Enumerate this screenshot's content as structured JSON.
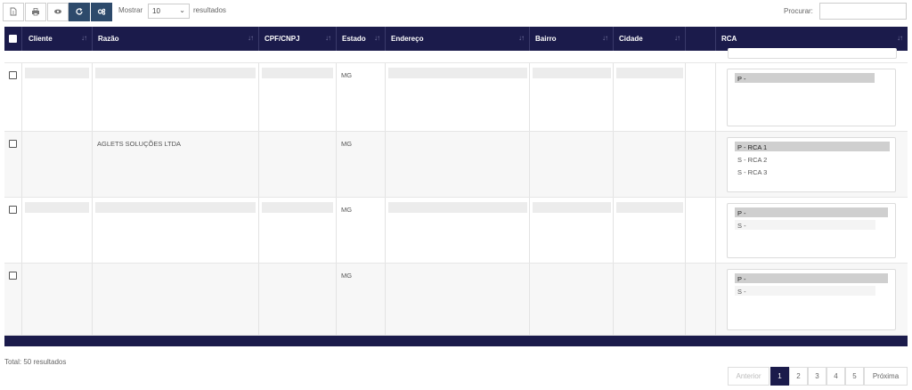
{
  "toolbar": {
    "buttons": [
      {
        "name": "file-icon"
      },
      {
        "name": "print-icon"
      },
      {
        "name": "eye-icon"
      },
      {
        "name": "refresh-icon"
      },
      {
        "name": "settings-icon"
      }
    ],
    "show_label": "Mostrar",
    "page_size": "10",
    "results_label": "resultados",
    "search_label": "Procurar:",
    "search_value": ""
  },
  "columns": [
    {
      "label": ""
    },
    {
      "label": "Cliente"
    },
    {
      "label": "Razão"
    },
    {
      "label": "CPF/CNPJ"
    },
    {
      "label": "Estado"
    },
    {
      "label": "Endereço"
    },
    {
      "label": "Bairro"
    },
    {
      "label": "Cidade"
    },
    {
      "label": ""
    },
    {
      "label": "RCA"
    }
  ],
  "rows": [
    {
      "cliente": "",
      "razao": "",
      "cpf": "",
      "estado": "MG",
      "endereco": "",
      "bairro": "",
      "cidade": "",
      "rca": [
        {
          "text": "P -",
          "kind": "primary"
        }
      ]
    },
    {
      "cliente": "",
      "razao": "AGLETS SOLUÇÕES LTDA",
      "cpf": "",
      "estado": "MG",
      "endereco": "",
      "bairro": "",
      "cidade": "",
      "rca": [
        {
          "text": "P - RCA 1",
          "kind": "primary"
        },
        {
          "text": "S - RCA 2",
          "kind": "plain"
        },
        {
          "text": "S - RCA 3",
          "kind": "plain"
        }
      ]
    },
    {
      "cliente": "",
      "razao": "",
      "cpf": "",
      "estado": "MG",
      "endereco": "",
      "bairro": "",
      "cidade": "",
      "rca": [
        {
          "text": "P -",
          "kind": "primary"
        },
        {
          "text": "S -",
          "kind": "secondary"
        }
      ]
    },
    {
      "cliente": "",
      "razao": "",
      "cpf": "",
      "estado": "MG",
      "endereco": "",
      "bairro": "",
      "cidade": "",
      "rca": [
        {
          "text": "P -",
          "kind": "primary"
        },
        {
          "text": "S -",
          "kind": "secondary"
        }
      ]
    }
  ],
  "footer": {
    "total": "Total: 50 resultados",
    "prev": "Anterior",
    "pages": [
      "1",
      "2",
      "3",
      "4",
      "5"
    ],
    "active_page": "1",
    "next": "Próxima"
  },
  "colors": {
    "header_bg": "#1b1b4b",
    "button_dark": "#2d4a6b"
  }
}
